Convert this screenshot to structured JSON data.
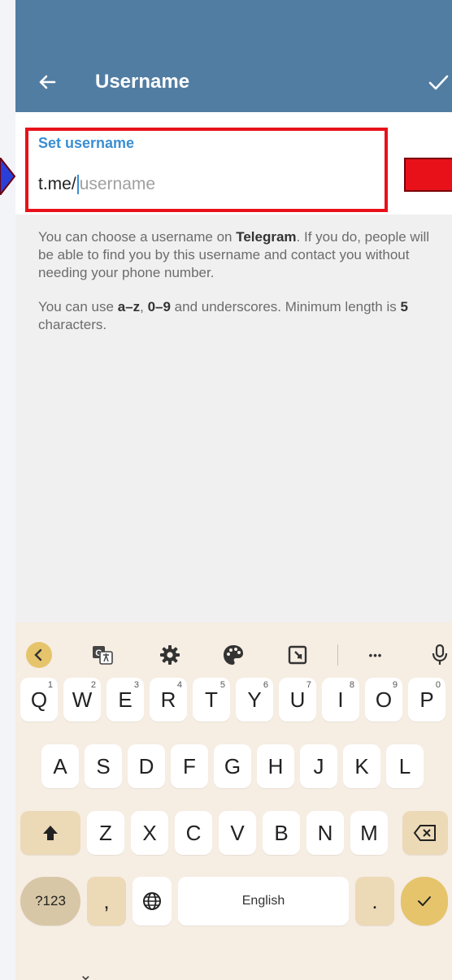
{
  "header": {
    "title": "Username"
  },
  "field": {
    "label": "Set username",
    "prefix": "t.me/",
    "placeholder": "username"
  },
  "help": {
    "para1_a": "You can choose a username on ",
    "para1_b": "Telegram",
    "para1_c": ". If you do, people will be able to find you by this username and contact you without needing your phone number.",
    "para2_a": "You can use ",
    "para2_b": "a–z",
    "para2_c": ", ",
    "para2_d": "0–9",
    "para2_e": " and underscores. Minimum length is ",
    "para2_f": "5",
    "para2_g": " characters."
  },
  "keyboard": {
    "row1": [
      {
        "k": "Q",
        "h": "1"
      },
      {
        "k": "W",
        "h": "2"
      },
      {
        "k": "E",
        "h": "3"
      },
      {
        "k": "R",
        "h": "4"
      },
      {
        "k": "T",
        "h": "5"
      },
      {
        "k": "Y",
        "h": "6"
      },
      {
        "k": "U",
        "h": "7"
      },
      {
        "k": "I",
        "h": "8"
      },
      {
        "k": "O",
        "h": "9"
      },
      {
        "k": "P",
        "h": "0"
      }
    ],
    "row2": [
      "A",
      "S",
      "D",
      "F",
      "G",
      "H",
      "J",
      "K",
      "L"
    ],
    "row3": [
      "Z",
      "X",
      "C",
      "V",
      "B",
      "N",
      "M"
    ],
    "symbols_label": "?123",
    "comma_label": ",",
    "space_label": "English",
    "period_label": ".",
    "more_label": "•••",
    "hide_glyph": "⌄"
  },
  "colors": {
    "appbar": "#527da3",
    "accent": "#3a8ed2",
    "highlight": "#e8111a"
  }
}
